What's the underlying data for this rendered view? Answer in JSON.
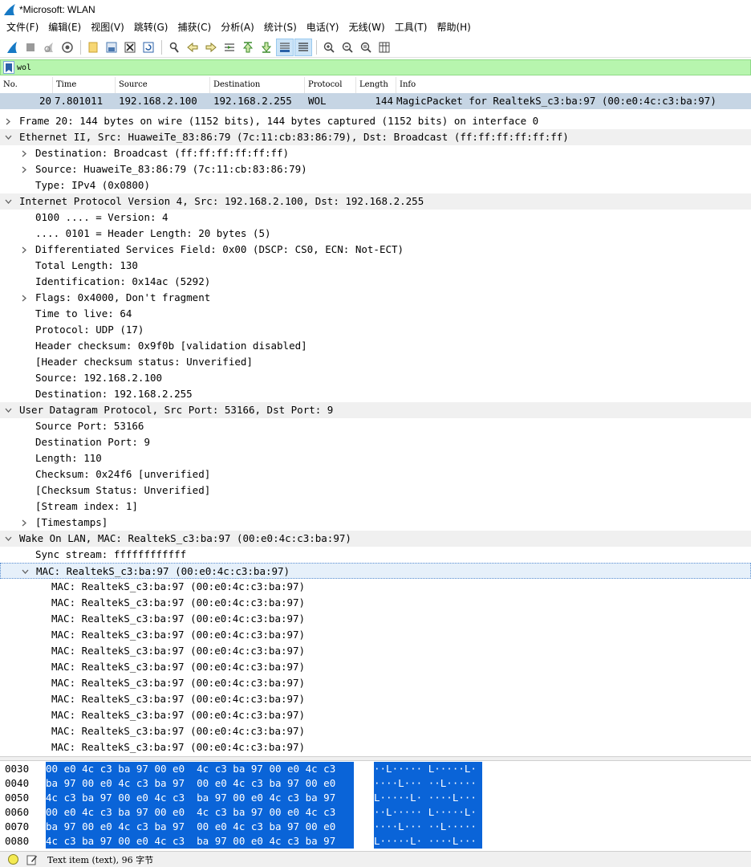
{
  "window": {
    "title": "*Microsoft: WLAN"
  },
  "menu": [
    "文件(F)",
    "编辑(E)",
    "视图(V)",
    "跳转(G)",
    "捕获(C)",
    "分析(A)",
    "统计(S)",
    "电话(Y)",
    "无线(W)",
    "工具(T)",
    "帮助(H)"
  ],
  "toolbar": {
    "icons": [
      "start-capture-icon",
      "stop-capture-icon",
      "restart-capture-icon",
      "capture-options-icon",
      "open-file-icon",
      "save-file-icon",
      "close-file-icon",
      "reload-file-icon",
      "find-packet-icon",
      "go-back-icon",
      "go-forward-icon",
      "go-to-packet-icon",
      "first-packet-icon",
      "last-packet-icon",
      "auto-scroll-icon",
      "colorize-icon",
      "zoom-in-icon",
      "zoom-out-icon",
      "normal-size-icon",
      "resize-columns-icon"
    ]
  },
  "filter": {
    "value": "wol"
  },
  "packet_list": {
    "columns": [
      "No.",
      "Time",
      "Source",
      "Destination",
      "Protocol",
      "Length",
      "Info"
    ],
    "rows": [
      {
        "no": "20",
        "time": "7.801011",
        "source": "192.168.2.100",
        "destination": "192.168.2.255",
        "protocol": "WOL",
        "length": "144",
        "info": "MagicPacket for RealtekS_c3:ba:97 (00:e0:4c:c3:ba:97)"
      }
    ]
  },
  "details": [
    {
      "text": "Frame 20: 144 bytes on wire (1152 bits), 144 bytes captured (1152 bits) on interface 0",
      "level": 0,
      "arrow": "collapsed",
      "header": false
    },
    {
      "text": "Ethernet II, Src: HuaweiTe_83:86:79 (7c:11:cb:83:86:79), Dst: Broadcast (ff:ff:ff:ff:ff:ff)",
      "level": 0,
      "arrow": "expanded",
      "header": true
    },
    {
      "text": "Destination: Broadcast (ff:ff:ff:ff:ff:ff)",
      "level": 1,
      "arrow": "collapsed",
      "header": false
    },
    {
      "text": "Source: HuaweiTe_83:86:79 (7c:11:cb:83:86:79)",
      "level": 1,
      "arrow": "collapsed",
      "header": false
    },
    {
      "text": "Type: IPv4 (0x0800)",
      "level": 1,
      "arrow": "none",
      "header": false
    },
    {
      "text": "Internet Protocol Version 4, Src: 192.168.2.100, Dst: 192.168.2.255",
      "level": 0,
      "arrow": "expanded",
      "header": true
    },
    {
      "text": "0100 .... = Version: 4",
      "level": 1,
      "arrow": "none",
      "header": false
    },
    {
      "text": ".... 0101 = Header Length: 20 bytes (5)",
      "level": 1,
      "arrow": "none",
      "header": false
    },
    {
      "text": "Differentiated Services Field: 0x00 (DSCP: CS0, ECN: Not-ECT)",
      "level": 1,
      "arrow": "collapsed",
      "header": false
    },
    {
      "text": "Total Length: 130",
      "level": 1,
      "arrow": "none",
      "header": false
    },
    {
      "text": "Identification: 0x14ac (5292)",
      "level": 1,
      "arrow": "none",
      "header": false
    },
    {
      "text": "Flags: 0x4000, Don't fragment",
      "level": 1,
      "arrow": "collapsed",
      "header": false
    },
    {
      "text": "Time to live: 64",
      "level": 1,
      "arrow": "none",
      "header": false
    },
    {
      "text": "Protocol: UDP (17)",
      "level": 1,
      "arrow": "none",
      "header": false
    },
    {
      "text": "Header checksum: 0x9f0b [validation disabled]",
      "level": 1,
      "arrow": "none",
      "header": false
    },
    {
      "text": "[Header checksum status: Unverified]",
      "level": 1,
      "arrow": "none",
      "header": false
    },
    {
      "text": "Source: 192.168.2.100",
      "level": 1,
      "arrow": "none",
      "header": false
    },
    {
      "text": "Destination: 192.168.2.255",
      "level": 1,
      "arrow": "none",
      "header": false
    },
    {
      "text": "User Datagram Protocol, Src Port: 53166, Dst Port: 9",
      "level": 0,
      "arrow": "expanded",
      "header": true
    },
    {
      "text": "Source Port: 53166",
      "level": 1,
      "arrow": "none",
      "header": false
    },
    {
      "text": "Destination Port: 9",
      "level": 1,
      "arrow": "none",
      "header": false
    },
    {
      "text": "Length: 110",
      "level": 1,
      "arrow": "none",
      "header": false
    },
    {
      "text": "Checksum: 0x24f6 [unverified]",
      "level": 1,
      "arrow": "none",
      "header": false
    },
    {
      "text": "[Checksum Status: Unverified]",
      "level": 1,
      "arrow": "none",
      "header": false
    },
    {
      "text": "[Stream index: 1]",
      "level": 1,
      "arrow": "none",
      "header": false
    },
    {
      "text": "[Timestamps]",
      "level": 1,
      "arrow": "collapsed",
      "header": false
    },
    {
      "text": "Wake On LAN, MAC: RealtekS_c3:ba:97 (00:e0:4c:c3:ba:97)",
      "level": 0,
      "arrow": "expanded",
      "header": true
    },
    {
      "text": "Sync stream: ffffffffffff",
      "level": 1,
      "arrow": "none",
      "header": false
    },
    {
      "text": "MAC: RealtekS_c3:ba:97 (00:e0:4c:c3:ba:97)",
      "level": 1,
      "arrow": "expanded",
      "header": false,
      "selected": true
    },
    {
      "text": "MAC: RealtekS_c3:ba:97 (00:e0:4c:c3:ba:97)",
      "level": 2,
      "arrow": "none",
      "header": false
    },
    {
      "text": "MAC: RealtekS_c3:ba:97 (00:e0:4c:c3:ba:97)",
      "level": 2,
      "arrow": "none",
      "header": false
    },
    {
      "text": "MAC: RealtekS_c3:ba:97 (00:e0:4c:c3:ba:97)",
      "level": 2,
      "arrow": "none",
      "header": false
    },
    {
      "text": "MAC: RealtekS_c3:ba:97 (00:e0:4c:c3:ba:97)",
      "level": 2,
      "arrow": "none",
      "header": false
    },
    {
      "text": "MAC: RealtekS_c3:ba:97 (00:e0:4c:c3:ba:97)",
      "level": 2,
      "arrow": "none",
      "header": false
    },
    {
      "text": "MAC: RealtekS_c3:ba:97 (00:e0:4c:c3:ba:97)",
      "level": 2,
      "arrow": "none",
      "header": false
    },
    {
      "text": "MAC: RealtekS_c3:ba:97 (00:e0:4c:c3:ba:97)",
      "level": 2,
      "arrow": "none",
      "header": false
    },
    {
      "text": "MAC: RealtekS_c3:ba:97 (00:e0:4c:c3:ba:97)",
      "level": 2,
      "arrow": "none",
      "header": false
    },
    {
      "text": "MAC: RealtekS_c3:ba:97 (00:e0:4c:c3:ba:97)",
      "level": 2,
      "arrow": "none",
      "header": false
    },
    {
      "text": "MAC: RealtekS_c3:ba:97 (00:e0:4c:c3:ba:97)",
      "level": 2,
      "arrow": "none",
      "header": false
    },
    {
      "text": "MAC: RealtekS_c3:ba:97 (00:e0:4c:c3:ba:97)",
      "level": 2,
      "arrow": "none",
      "header": false
    }
  ],
  "bytes": [
    {
      "offset": "0030",
      "hex": "00 e0 4c c3 ba 97 00 e0  4c c3 ba 97 00 e0 4c c3",
      "ascii": "··L····· L·····L·"
    },
    {
      "offset": "0040",
      "hex": "ba 97 00 e0 4c c3 ba 97  00 e0 4c c3 ba 97 00 e0",
      "ascii": "····L··· ··L·····"
    },
    {
      "offset": "0050",
      "hex": "4c c3 ba 97 00 e0 4c c3  ba 97 00 e0 4c c3 ba 97",
      "ascii": "L·····L· ····L···"
    },
    {
      "offset": "0060",
      "hex": "00 e0 4c c3 ba 97 00 e0  4c c3 ba 97 00 e0 4c c3",
      "ascii": "··L····· L·····L·"
    },
    {
      "offset": "0070",
      "hex": "ba 97 00 e0 4c c3 ba 97  00 e0 4c c3 ba 97 00 e0",
      "ascii": "····L··· ··L·····"
    },
    {
      "offset": "0080",
      "hex": "4c c3 ba 97 00 e0 4c c3  ba 97 00 e0 4c c3 ba 97",
      "ascii": "L·····L· ····L···"
    }
  ],
  "status": {
    "text": "Text item (text), 96 字节"
  },
  "colors": {
    "selected_row": "#c6d5e4",
    "filter_ok": "#b7f5ae",
    "byte_highlight": "#0a64d8",
    "tree_header": "#f0f0f0"
  }
}
